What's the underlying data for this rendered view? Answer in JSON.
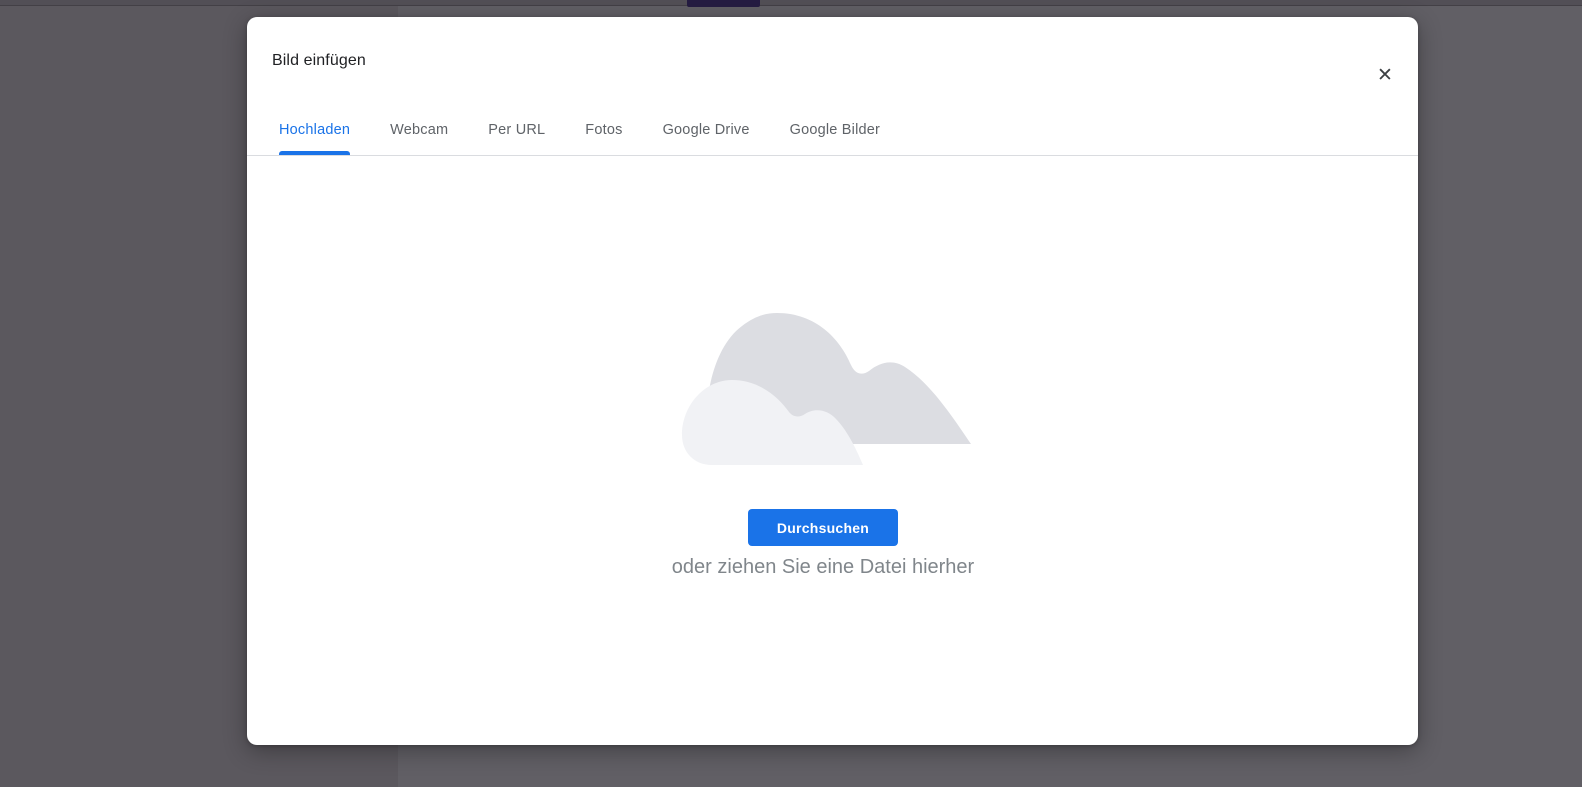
{
  "dialog": {
    "title": "Bild einfügen",
    "close_icon": "✕",
    "tabs": [
      {
        "label": "Hochladen",
        "active": true
      },
      {
        "label": "Webcam",
        "active": false
      },
      {
        "label": "Per URL",
        "active": false
      },
      {
        "label": "Fotos",
        "active": false
      },
      {
        "label": "Google Drive",
        "active": false
      },
      {
        "label": "Google Bilder",
        "active": false
      }
    ],
    "upload": {
      "browse_button": "Durchsuchen",
      "drag_hint": "oder ziehen Sie eine Datei hierher"
    }
  },
  "colors": {
    "accent_blue": "#1a73e8",
    "tab_inactive_text": "#5f6368",
    "title_text": "#202124",
    "drag_hint_text": "#80868b",
    "cloud_back": "#dcdde2",
    "cloud_front": "#f1f2f5",
    "overlay_left": "#5b585e",
    "overlay_right": "#615f65",
    "page_accent_bar": "#251c42"
  }
}
